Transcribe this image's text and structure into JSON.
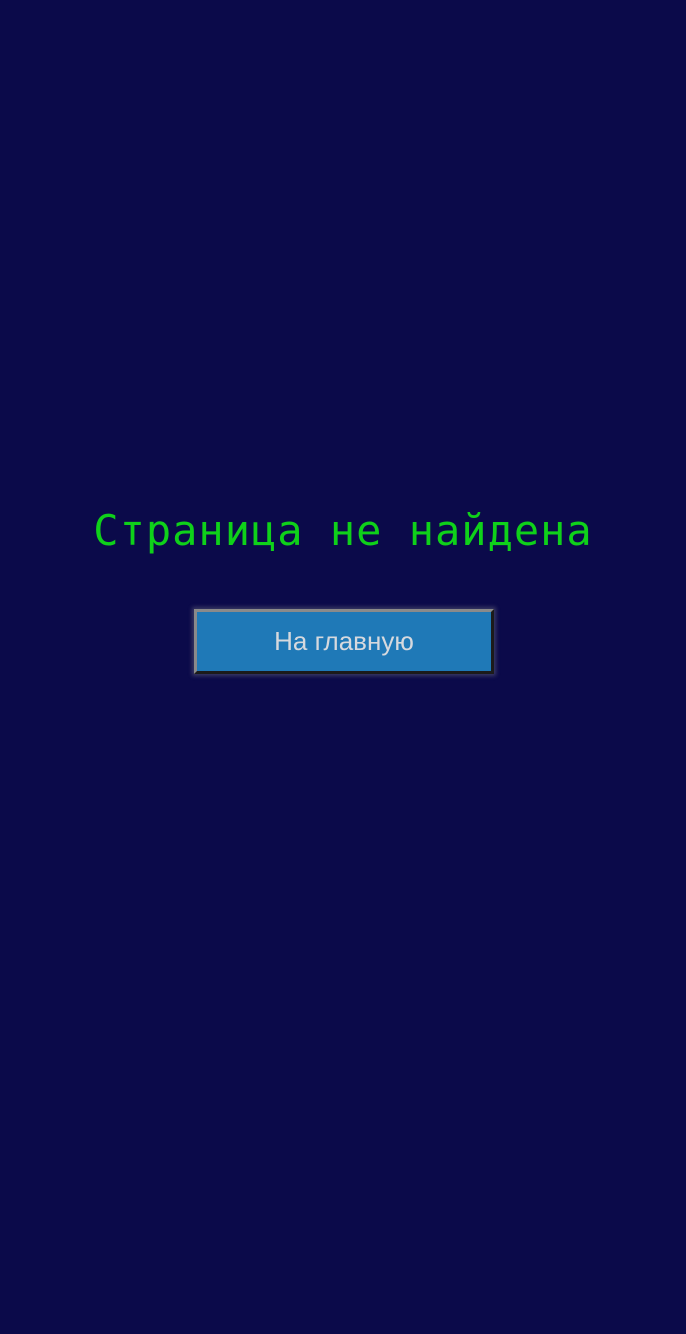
{
  "page": {
    "background": "#0b0a4a",
    "title": "Страница не найдена",
    "title_color": "#0fd11a"
  },
  "actions": {
    "home_button_label": "На главную",
    "home_button_color": "#1f79b7"
  }
}
